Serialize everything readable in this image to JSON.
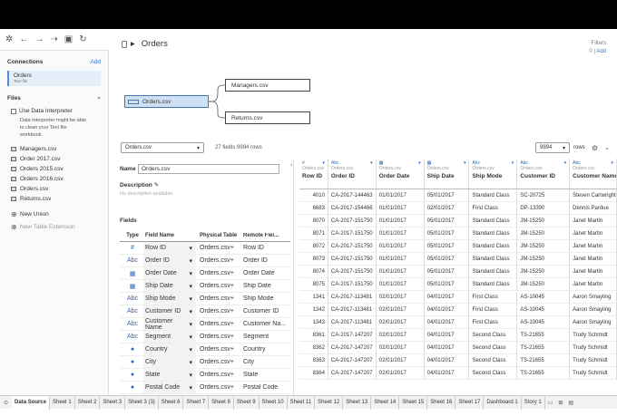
{
  "left": {
    "connections_title": "Connections",
    "add_label": "Add",
    "connection_name": "Orders",
    "connection_type": "Text file",
    "files_title": "Files",
    "use_interpreter": "Use Data Interpreter",
    "interpreter_note": "Data Interpreter might be able to clean your Text file workbook.",
    "files": [
      "Managers.csv",
      "Order 2017.csv",
      "Orders 2015.csv",
      "Orders 2016.csv",
      "Orders.csv",
      "Returns.csv"
    ],
    "new_union": "New Union",
    "new_table_extension": "New Table Extension"
  },
  "canvas": {
    "title": "Orders",
    "filters_label": "Filters",
    "filters_count": "0",
    "filters_add": "Add",
    "tables": {
      "main": "Orders.csv",
      "managers": "Managers.csv",
      "returns": "Returns.csv"
    }
  },
  "toolbar": {
    "table_select": "Orders.csv",
    "fields_info": "27 fields 9994 rows",
    "rows_value": "9994",
    "rows_label": "rows"
  },
  "meta": {
    "name_label": "Name",
    "name_value": "Orders.csv",
    "description_label": "Description",
    "description_placeholder": "No description available",
    "fields_label": "Fields",
    "headers": [
      "Type",
      "Field Name",
      "Physical Table",
      "Remote Fiel..."
    ],
    "rows": [
      {
        "type": "#",
        "name": "Row ID",
        "table": "Orders.csv+",
        "remote": "Row ID"
      },
      {
        "type": "Abc",
        "name": "Order ID",
        "table": "Orders.csv+",
        "remote": "Order ID"
      },
      {
        "type": "▦",
        "name": "Order Date",
        "table": "Orders.csv+",
        "remote": "Order Date"
      },
      {
        "type": "▦",
        "name": "Ship Date",
        "table": "Orders.csv+",
        "remote": "Ship Date"
      },
      {
        "type": "Abc",
        "name": "Ship Mode",
        "table": "Orders.csv+",
        "remote": "Ship Mode"
      },
      {
        "type": "Abc",
        "name": "Customer ID",
        "table": "Orders.csv+",
        "remote": "Customer ID"
      },
      {
        "type": "Abc",
        "name": "Customer Name",
        "table": "Orders.csv+",
        "remote": "Customer Na..."
      },
      {
        "type": "Abc",
        "name": "Segment",
        "table": "Orders.csv+",
        "remote": "Segment"
      },
      {
        "type": "●",
        "name": "Country",
        "table": "Orders.csv+",
        "remote": "Country"
      },
      {
        "type": "●",
        "name": "City",
        "table": "Orders.csv+",
        "remote": "City"
      },
      {
        "type": "●",
        "name": "State",
        "table": "Orders.csv+",
        "remote": "State"
      },
      {
        "type": "●",
        "name": "Postal Code",
        "table": "Orders.csv+",
        "remote": "Postal Code"
      }
    ]
  },
  "grid": {
    "columns": [
      {
        "type": "#",
        "src": "Orders.csv",
        "name": "Row ID"
      },
      {
        "type": "Abc",
        "src": "Orders.csv",
        "name": "Order ID"
      },
      {
        "type": "▦",
        "src": "Orders.csv",
        "name": "Order Date"
      },
      {
        "type": "▦",
        "src": "Orders.csv",
        "name": "Ship Date"
      },
      {
        "type": "Abc",
        "src": "Orders.csv",
        "name": "Ship Mode"
      },
      {
        "type": "Abc",
        "src": "Orders.csv",
        "name": "Customer ID"
      },
      {
        "type": "Abc",
        "src": "Orders.csv",
        "name": "Customer Name"
      }
    ],
    "rows": [
      [
        "4010",
        "CA-2017-144463",
        "01/01/2017",
        "05/01/2017",
        "Standard Class",
        "SC-20725",
        "Steven Cartwright"
      ],
      [
        "6683",
        "CA-2017-154466",
        "01/01/2017",
        "02/01/2017",
        "First Class",
        "DP-13390",
        "Dennis Pardue"
      ],
      [
        "8070",
        "CA-2017-151750",
        "01/01/2017",
        "05/01/2017",
        "Standard Class",
        "JM-15250",
        "Janet Martin"
      ],
      [
        "8071",
        "CA-2017-151750",
        "01/01/2017",
        "05/01/2017",
        "Standard Class",
        "JM-15250",
        "Janet Martin"
      ],
      [
        "8072",
        "CA-2017-151750",
        "01/01/2017",
        "05/01/2017",
        "Standard Class",
        "JM-15250",
        "Janet Martin"
      ],
      [
        "8073",
        "CA-2017-151750",
        "01/01/2017",
        "05/01/2017",
        "Standard Class",
        "JM-15250",
        "Janet Martin"
      ],
      [
        "8074",
        "CA-2017-151750",
        "01/01/2017",
        "05/01/2017",
        "Standard Class",
        "JM-15250",
        "Janet Martin"
      ],
      [
        "8075",
        "CA-2017-151750",
        "01/01/2017",
        "05/01/2017",
        "Standard Class",
        "JM-15250",
        "Janet Martin"
      ],
      [
        "1341",
        "CA-2017-113481",
        "02/01/2017",
        "04/01/2017",
        "First Class",
        "AS-10045",
        "Aaron Smayling"
      ],
      [
        "1342",
        "CA-2017-113481",
        "02/01/2017",
        "04/01/2017",
        "First Class",
        "AS-10045",
        "Aaron Smayling"
      ],
      [
        "1343",
        "CA-2017-113481",
        "02/01/2017",
        "04/01/2017",
        "First Class",
        "AS-10045",
        "Aaron Smayling"
      ],
      [
        "8361",
        "CA-2017-147207",
        "02/01/2017",
        "04/01/2017",
        "Second Class",
        "TS-21655",
        "Trudy Schmidt"
      ],
      [
        "8362",
        "CA-2017-147207",
        "02/01/2017",
        "04/01/2017",
        "Second Class",
        "TS-21655",
        "Trudy Schmidt"
      ],
      [
        "8363",
        "CA-2017-147207",
        "02/01/2017",
        "04/01/2017",
        "Second Class",
        "TS-21655",
        "Trudy Schmidt"
      ],
      [
        "8364",
        "CA-2017-147207",
        "02/01/2017",
        "04/01/2017",
        "Second Class",
        "TS-21655",
        "Trudy Schmidt"
      ]
    ]
  },
  "tabs": [
    "Data Source",
    "Sheet 1",
    "Sheet 2",
    "Sheet 3",
    "Sheet 3 (3)",
    "Sheet 6",
    "Sheet 7",
    "Sheet 8",
    "Sheet 9",
    "Sheet 10",
    "Sheet 11",
    "Sheet 12",
    "Sheet 13",
    "Sheet 14",
    "Sheet 15",
    "Sheet 16",
    "Sheet 17",
    "Dashboard 1",
    "Story 1"
  ]
}
